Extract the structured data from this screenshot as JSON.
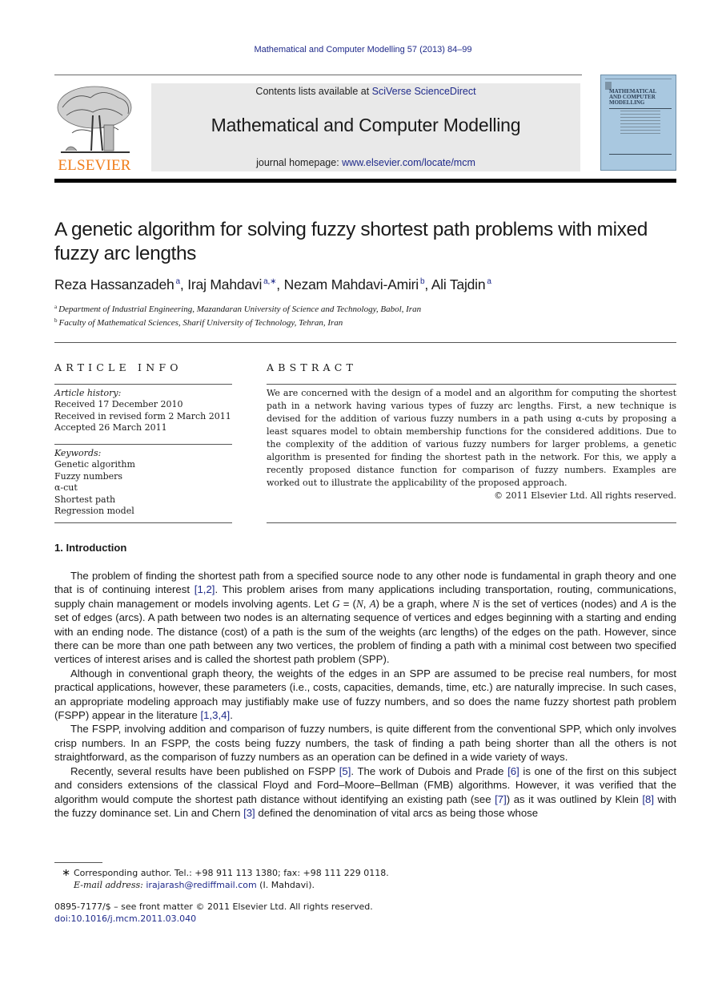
{
  "running_head": "Mathematical and Computer Modelling 57 (2013) 84–99",
  "publisher": {
    "name": "ELSEVIER",
    "brand_color": "#f07d1a"
  },
  "banner": {
    "contents_prefix": "Contents lists available at ",
    "contents_link": "SciVerse ScienceDirect",
    "journal_title": "Mathematical and Computer Modelling",
    "homepage_prefix": "journal homepage: ",
    "homepage_link": "www.elsevier.com/locate/mcm"
  },
  "cover": {
    "title": "MATHEMATICAL\nAND COMPUTER\nMODELLING"
  },
  "article": {
    "title": "A genetic algorithm for solving fuzzy shortest path problems with mixed fuzzy arc lengths",
    "authors": [
      {
        "name": "Reza Hassanzadeh",
        "sup": "a"
      },
      {
        "name": "Iraj Mahdavi",
        "sup": "a,∗"
      },
      {
        "name": "Nezam Mahdavi-Amiri",
        "sup": "b"
      },
      {
        "name": "Ali Tajdin",
        "sup": "a"
      }
    ],
    "affiliations": [
      {
        "sup": "a",
        "text": "Department of Industrial Engineering, Mazandaran University of Science and Technology, Babol, Iran"
      },
      {
        "sup": "b",
        "text": "Faculty of Mathematical Sciences, Sharif University of Technology, Tehran, Iran"
      }
    ]
  },
  "article_info": {
    "heading": "ARTICLE INFO",
    "history_label": "Article history:",
    "history": [
      "Received 17 December 2010",
      "Received in revised form 2 March 2011",
      "Accepted 26 March 2011"
    ],
    "keywords_label": "Keywords:",
    "keywords": [
      "Genetic algorithm",
      "Fuzzy numbers",
      "α-cut",
      "Shortest path",
      "Regression model"
    ]
  },
  "abstract": {
    "heading": "ABSTRACT",
    "text": "We are concerned with the design of a model and an algorithm for computing the shortest path in a network having various types of fuzzy arc lengths. First, a new technique is devised for the addition of various fuzzy numbers in a path using α-cuts by proposing a least squares model to obtain membership functions for the considered additions. Due to the complexity of the addition of various fuzzy numbers for larger problems, a genetic algorithm is presented for finding the shortest path in the network. For this, we apply a recently proposed distance function for comparison of fuzzy numbers. Examples are worked out to illustrate the applicability of the proposed approach.",
    "copyright": "© 2011 Elsevier Ltd. All rights reserved."
  },
  "introduction": {
    "heading": "1.  Introduction",
    "paragraphs": [
      [
        {
          "t": "The problem of finding the shortest path from a specified source node to any other node is fundamental in graph theory and one that is of continuing interest "
        },
        {
          "t": "[1,2]",
          "ref": true
        },
        {
          "t": ". This problem arises from many applications including transportation, routing, communications, supply chain management or models involving agents. Let "
        },
        {
          "t": "G",
          "math": true
        },
        {
          "t": " = ("
        },
        {
          "t": "N",
          "math": true
        },
        {
          "t": ", "
        },
        {
          "t": "A",
          "math": true
        },
        {
          "t": ") be a graph, where "
        },
        {
          "t": "N",
          "math": true
        },
        {
          "t": " is the set of vertices (nodes) and "
        },
        {
          "t": "A",
          "math": true
        },
        {
          "t": " is the set of edges (arcs). A path between two nodes is an alternating sequence of vertices and edges beginning with a starting and ending with an ending node. The distance (cost) of a path is the sum of the weights (arc lengths) of the edges on the path. However, since there can be more than one path between any two vertices, the problem of finding a path with a minimal cost between two specified vertices of interest arises and is called the shortest path problem (SPP)."
        }
      ],
      [
        {
          "t": "Although in conventional graph theory, the weights of the edges in an SPP are assumed to be precise real numbers, for most practical applications, however, these parameters (i.e., costs, capacities, demands, time, etc.) are naturally imprecise. In such cases, an appropriate modeling approach may justifiably make use of fuzzy numbers, and so does the name fuzzy shortest path problem (FSPP) appear in the literature "
        },
        {
          "t": "[1,3,4]",
          "ref": true
        },
        {
          "t": "."
        }
      ],
      [
        {
          "t": "The FSPP, involving addition and comparison of fuzzy numbers, is quite different from the conventional SPP, which only involves crisp numbers. In an FSPP, the costs being fuzzy numbers, the task of finding a path being shorter than all the others is not straightforward, as the comparison of fuzzy numbers as an operation can be defined in a wide variety of ways."
        }
      ],
      [
        {
          "t": "Recently, several results have been published on FSPP "
        },
        {
          "t": "[5]",
          "ref": true
        },
        {
          "t": ". The work of Dubois and Prade "
        },
        {
          "t": "[6]",
          "ref": true
        },
        {
          "t": " is one of the first on this subject and considers extensions of the classical Floyd and Ford–Moore–Bellman (FMB) algorithms. However, it was verified that the algorithm would compute the shortest path distance without identifying an existing path (see "
        },
        {
          "t": "[7]",
          "ref": true
        },
        {
          "t": ") as it was outlined by Klein "
        },
        {
          "t": "[8]",
          "ref": true
        },
        {
          "t": " with the fuzzy dominance set. Lin and Chern "
        },
        {
          "t": "[3]",
          "ref": true
        },
        {
          "t": " defined the denomination of vital arcs as being those whose"
        }
      ]
    ]
  },
  "footnotes": {
    "star": "∗",
    "corresponding": "Corresponding author. Tel.: +98 911 113 1380; fax: +98 111 229 0118.",
    "email_label": "E-mail address: ",
    "email": "irajarash@rediffmail.com",
    "email_suffix": " (I. Mahdavi).",
    "issn_line": "0895-7177/$ – see front matter © 2011 Elsevier Ltd. All rights reserved.",
    "doi": "doi:10.1016/j.mcm.2011.03.040"
  }
}
